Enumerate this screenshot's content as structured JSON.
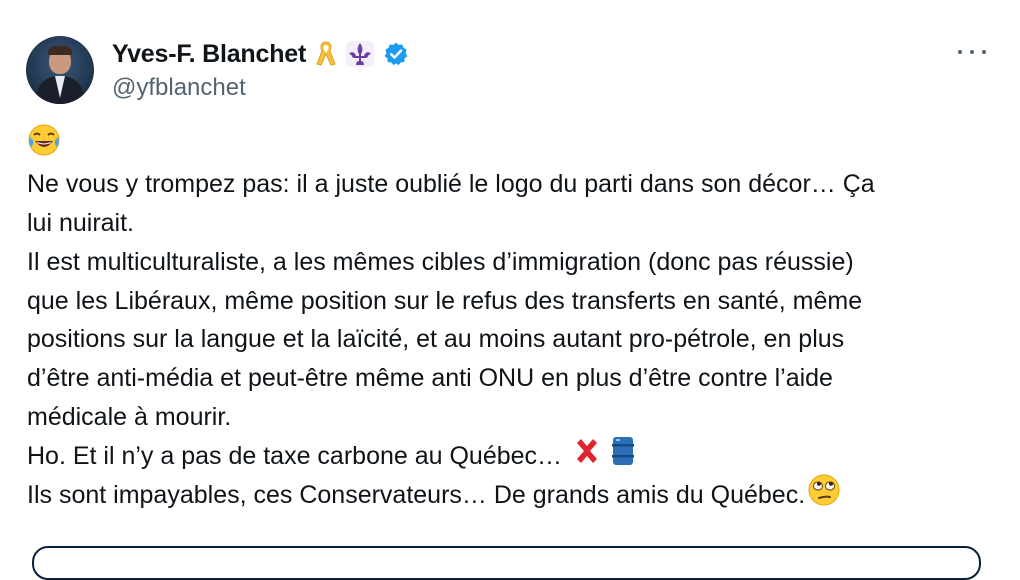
{
  "author": {
    "name": "Yves-F. Blanchet",
    "handle": "@yfblanchet",
    "badges": [
      "yellow-ribbon-icon",
      "fleur-de-lis-icon",
      "verified-badge-icon"
    ]
  },
  "menu": {
    "more_icon": "more-horizontal-icon"
  },
  "tweet": {
    "lines": [
      "",
      "Ne vous y trompez pas: il a juste oublié le logo du parti dans son décor… Ça",
      "lui nuirait.",
      "Il est multiculturaliste, a les mêmes cibles d’immigration (donc pas réussie)",
      "que les Libéraux, même position sur le refus des transferts en santé, même",
      "positions sur la langue et la laïcité, et au moins autant pro-pétrole, en plus",
      "d’être anti-média et peut-être même anti ONU en plus d’être contre l’aide",
      "médicale à mourir.",
      "Ho. Et il n’y a pas de taxe carbone au Québec…",
      "Ils sont impayables, ces Conservateurs…  De grands amis du Québec."
    ],
    "emojis": {
      "first_line": "tears-of-joy-emoji",
      "line8_a": "red-x-emoji",
      "line8_b": "oil-drum-emoji",
      "line9": "eye-roll-emoji"
    }
  },
  "colors": {
    "text": "#0f1419",
    "secondary": "#536471",
    "verified": "#1d9bf0"
  }
}
